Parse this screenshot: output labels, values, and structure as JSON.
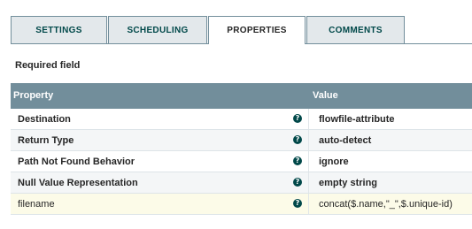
{
  "tabs": [
    {
      "label": "SETTINGS",
      "selected": false
    },
    {
      "label": "SCHEDULING",
      "selected": false
    },
    {
      "label": "PROPERTIES",
      "selected": true
    },
    {
      "label": "COMMENTS",
      "selected": false
    }
  ],
  "required_field_label": "Required field",
  "table": {
    "headers": {
      "property": "Property",
      "value": "Value"
    },
    "help_icon": "question-circle-icon",
    "rows": [
      {
        "property": "Destination",
        "value": "flowfile-attribute",
        "required": true
      },
      {
        "property": "Return Type",
        "value": "auto-detect",
        "required": true
      },
      {
        "property": "Path Not Found Behavior",
        "value": "ignore",
        "required": true
      },
      {
        "property": "Null Value Representation",
        "value": "empty string",
        "required": true
      },
      {
        "property": "filename",
        "value": "concat($.name,\"_\",$.unique-id)",
        "required": false
      }
    ]
  },
  "colors": {
    "header_bg": "#728e9b",
    "tab_bg": "#e3e8eb",
    "tab_text": "#004849",
    "custom_row_bg": "#fcfbe8"
  }
}
